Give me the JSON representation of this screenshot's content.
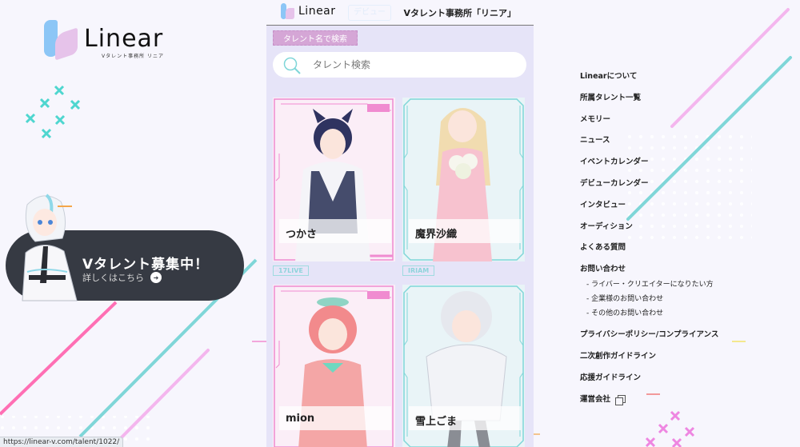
{
  "logo": {
    "wordmark": "Linear",
    "subtitle": "Vタレント事務所 リニア"
  },
  "recruit_banner": {
    "title": "Vタレント募集中！",
    "link_label": "詳しくはこちら",
    "link_icon": "arrow-right-icon"
  },
  "header": {
    "logo_wordmark": "Linear",
    "ghost_button_label": "デビュー",
    "agency_title": "Vタレント事務所「リニア」"
  },
  "search": {
    "section_label": "タレント名で検索",
    "placeholder": "タレント検索",
    "value": "",
    "icon": "search-icon"
  },
  "talents": [
    {
      "name": "つかさ",
      "platform": "17LIVE",
      "theme": "pink"
    },
    {
      "name": "魔界沙織",
      "platform": "IRIAM",
      "theme": "cyan"
    },
    {
      "name": "mion",
      "platform": "",
      "theme": "pink"
    },
    {
      "name": "雪上ごま",
      "platform": "",
      "theme": "cyan"
    }
  ],
  "nav": {
    "items": [
      {
        "label": "Linearについて"
      },
      {
        "label": "所属タレント一覧"
      },
      {
        "label": "メモリー"
      },
      {
        "label": "ニュース"
      },
      {
        "label": "イベントカレンダー"
      },
      {
        "label": "デビューカレンダー"
      },
      {
        "label": "インタビュー"
      },
      {
        "label": "オーディション"
      },
      {
        "label": "よくある質問"
      },
      {
        "label": "お問い合わせ"
      }
    ],
    "contact_sub": [
      {
        "label": "- ライバー・クリエイターになりたい方"
      },
      {
        "label": "- 企業様のお問い合わせ"
      },
      {
        "label": "- その他のお問い合わせ"
      }
    ],
    "bottom_items": [
      {
        "label": "プライバシーポリシー/コンプライアンス"
      },
      {
        "label": "二次創作ガイドライン"
      },
      {
        "label": "応援ガイドライン"
      },
      {
        "label": "運営会社",
        "icon": "external-link-icon"
      }
    ]
  },
  "status_bar": {
    "url": "https://linear-v.com/talent/1022/"
  },
  "colors": {
    "pink": "#f08bd0",
    "cyan": "#7fd6d8",
    "hot_pink": "#ff6fb4",
    "banner": "#363a43",
    "panel": "#e6e4f8"
  }
}
